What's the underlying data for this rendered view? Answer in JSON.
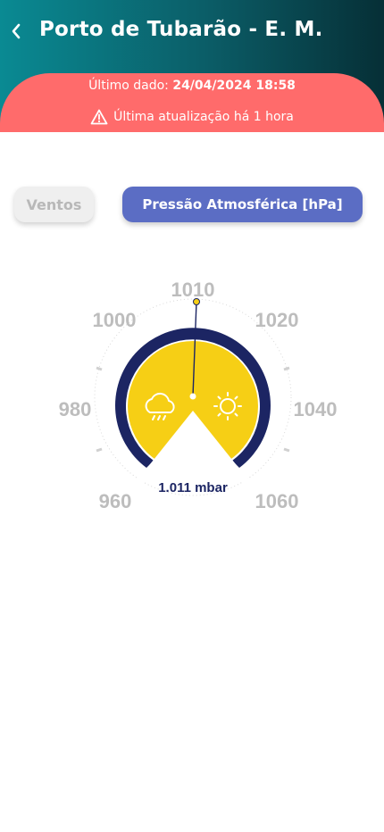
{
  "header": {
    "title": "Porto de Tubarão - E. M.",
    "last_data_label": "Último dado:",
    "last_data_value": "24/04/2024 18:58",
    "last_update": "Última atualização há 1 hora"
  },
  "tabs": {
    "ventos": "Ventos",
    "pressao": "Pressão Atmosférica [hPa]"
  },
  "gauge": {
    "reading": "1.011 mbar",
    "value": 1011,
    "min": 960,
    "max": 1060,
    "ticks": [
      "960",
      "980",
      "1000",
      "1010",
      "1020",
      "1040",
      "1060"
    ],
    "left_icon": "rain-cloud-icon",
    "right_icon": "sun-icon",
    "colors": {
      "header_start": "#0a8a93",
      "header_end": "#062f36",
      "alert": "#ff6b6b",
      "active_tab": "#5b6dc4",
      "gauge_fill": "#f6cf15",
      "gauge_ring": "#1c2563"
    }
  }
}
